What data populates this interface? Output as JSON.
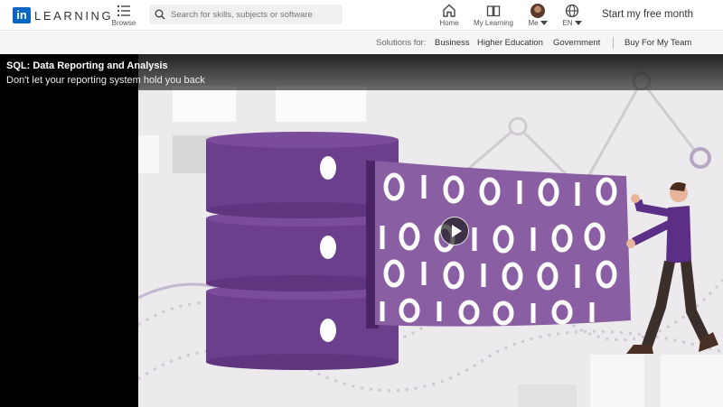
{
  "header": {
    "logo_box": "in",
    "logo_text": "LEARNING",
    "browse_label": "Browse",
    "search_placeholder": "Search for skills, subjects or software",
    "nav": {
      "home": "Home",
      "my_learning": "My Learning",
      "me": "Me",
      "language": "EN"
    },
    "start_free": "Start my free month"
  },
  "subnav": {
    "label": "Solutions for:",
    "links": [
      "Business",
      "Higher Education",
      "Government"
    ],
    "buy": "Buy For My Team"
  },
  "video": {
    "title": "SQL: Data Reporting and Analysis",
    "subtitle": "Don't let your reporting system hold you back",
    "colors": {
      "purple": "#6b3f8c",
      "banner": "#8a5ea3",
      "background": "#eceaec"
    }
  }
}
